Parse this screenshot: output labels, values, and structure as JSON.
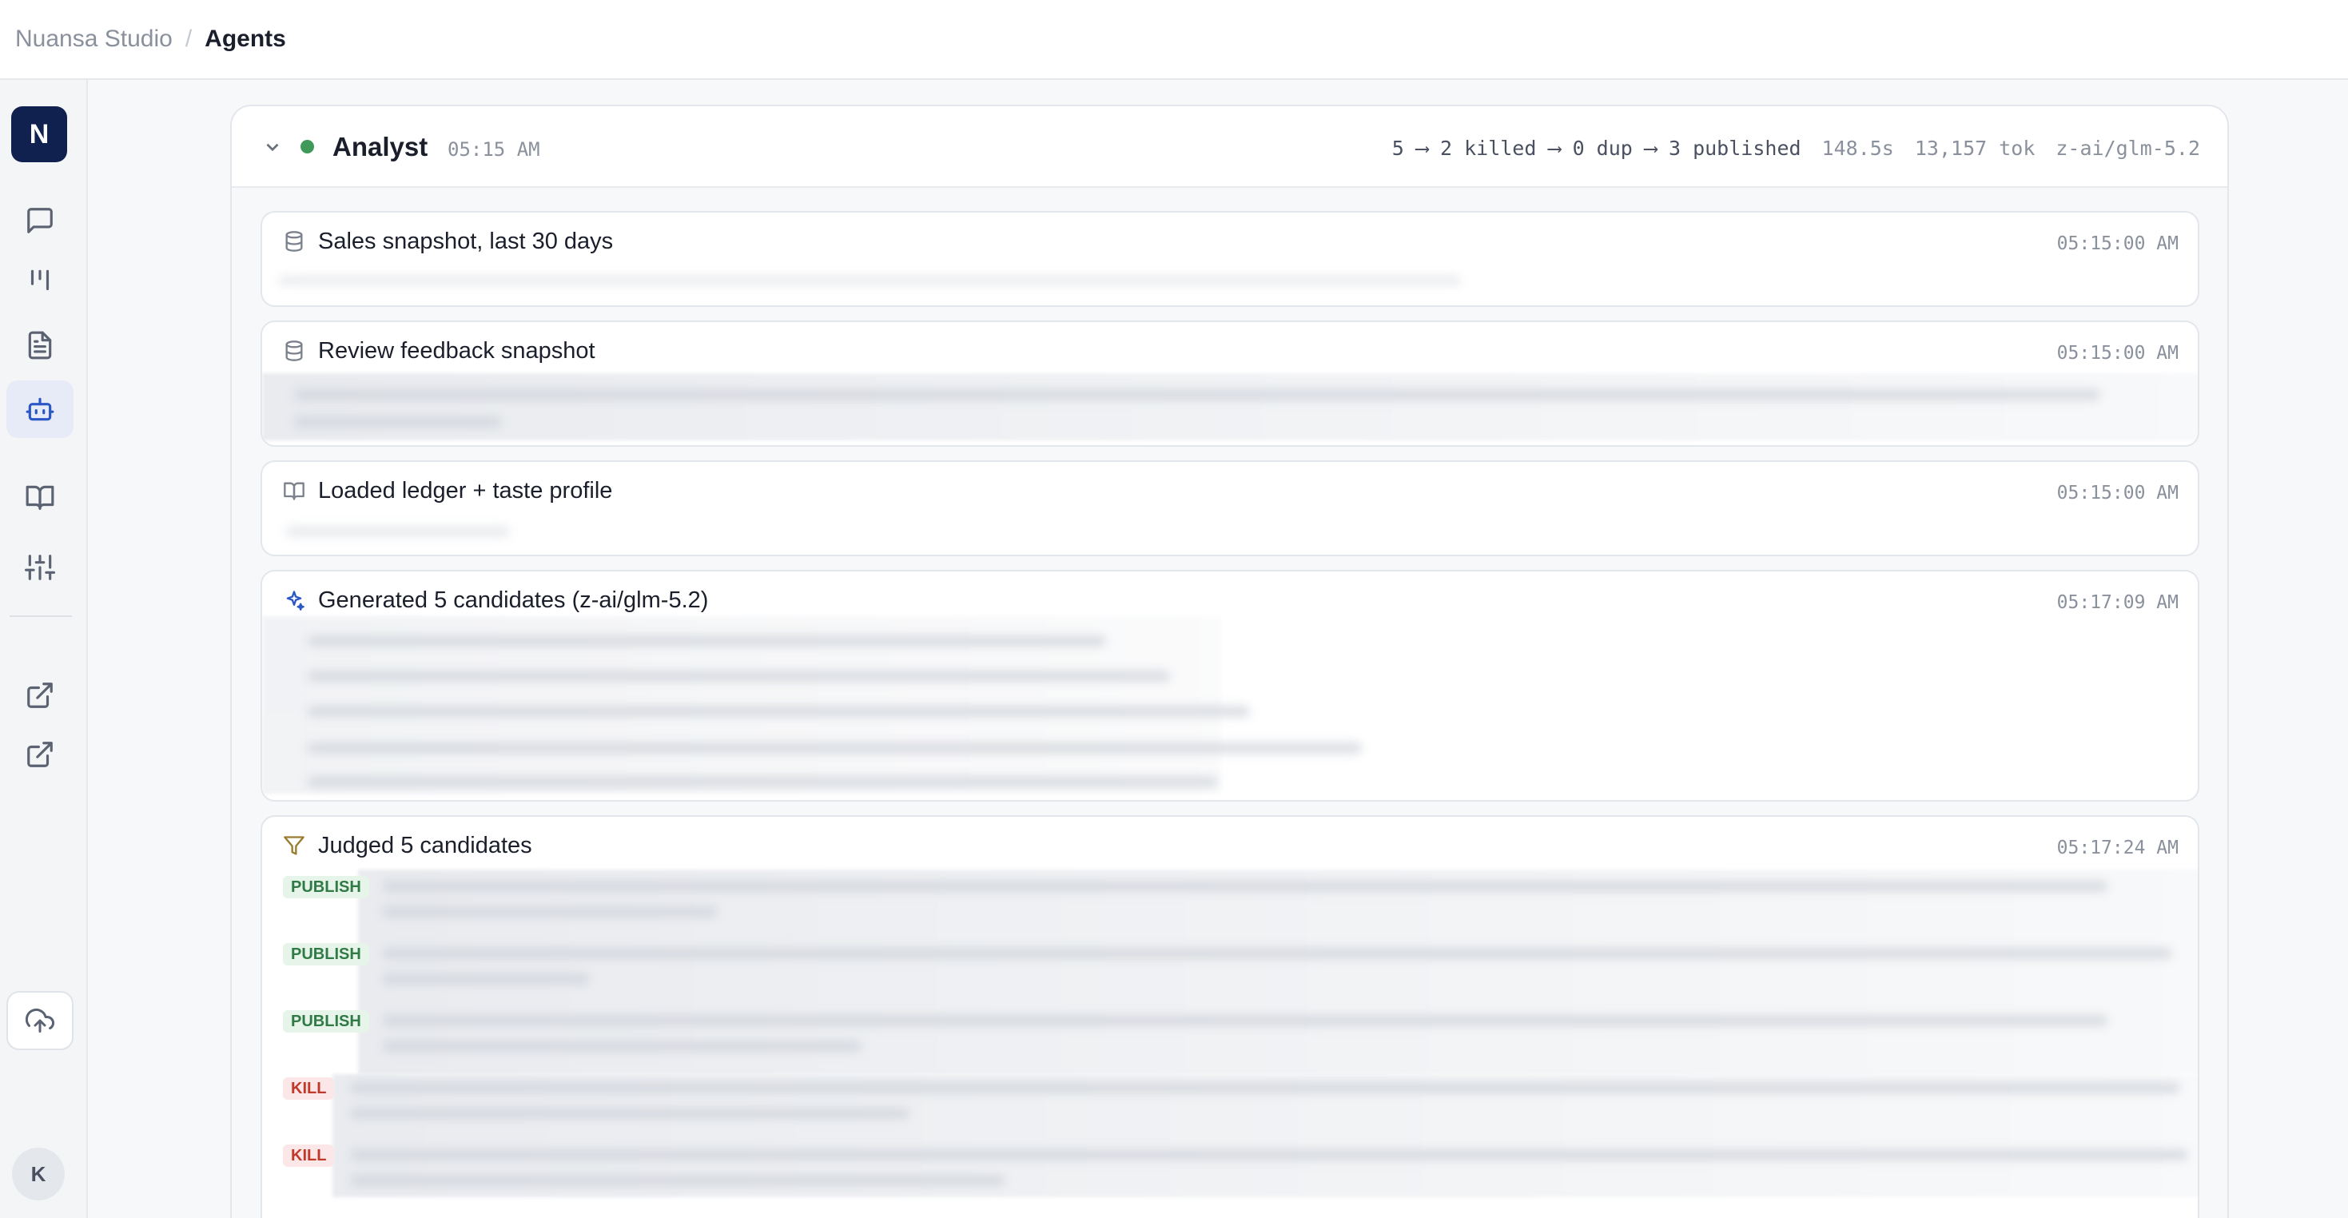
{
  "breadcrumb": {
    "studio": "Nuansa Studio",
    "separator": "/",
    "page": "Agents"
  },
  "sidebar": {
    "logo_letter": "N",
    "items": [
      {
        "name": "chat",
        "icon": "message-square-icon"
      },
      {
        "name": "board",
        "icon": "columns-icon"
      },
      {
        "name": "documents",
        "icon": "file-text-icon"
      },
      {
        "name": "agents",
        "icon": "bot-icon",
        "active": true
      },
      {
        "name": "library",
        "icon": "book-open-icon"
      },
      {
        "name": "settings",
        "icon": "sliders-icon"
      },
      {
        "name": "external-1",
        "icon": "external-link-icon"
      },
      {
        "name": "external-2",
        "icon": "external-link-icon"
      }
    ],
    "sync_icon": "cloud-upload-icon",
    "user_initial": "K"
  },
  "run": {
    "agent_name": "Analyst",
    "time": "05:15 AM",
    "status_color": "#3f9a5a",
    "pipeline": "5 ⟶ 2 killed ⟶ 0 dup ⟶ 3 published",
    "duration": "148.5s",
    "tokens": "13,157 tok",
    "model": "z-ai/glm-5.2"
  },
  "steps": [
    {
      "title": "Sales snapshot, last 30 days",
      "time": "05:15:00 AM",
      "icon": "database-icon"
    },
    {
      "title": "Review feedback snapshot",
      "time": "05:15:00 AM",
      "icon": "database-icon"
    },
    {
      "title": "Loaded ledger + taste profile",
      "time": "05:15:00 AM",
      "icon": "book-open-icon"
    },
    {
      "title": "Generated 5 candidates (z-ai/glm-5.2)",
      "time": "05:17:09 AM",
      "icon": "sparkles-icon"
    },
    {
      "title": "Judged 5 candidates",
      "time": "05:17:24 AM",
      "icon": "filter-icon"
    }
  ],
  "verdicts": [
    "PUBLISH",
    "PUBLISH",
    "PUBLISH",
    "KILL",
    "KILL"
  ],
  "colors": {
    "accent": "#2b57c6",
    "logo_bg": "#10204f",
    "publish": "#2f7a45",
    "kill": "#c0392b"
  }
}
